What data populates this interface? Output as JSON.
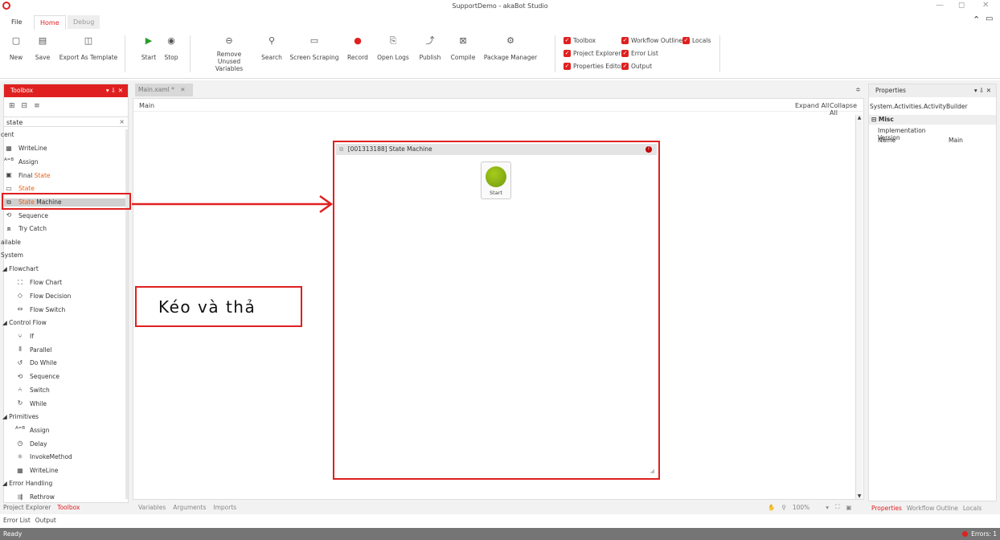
{
  "window": {
    "title": "SupportDemo - akaBot Studio",
    "minimize": "—",
    "restore": "◻",
    "close": "✕"
  },
  "menu": {
    "file": "File",
    "home": "Home",
    "debug": "Debug"
  },
  "ribbon": {
    "buttons": [
      {
        "icon": "▢",
        "label": "New"
      },
      {
        "icon": "▤",
        "label": "Save"
      },
      {
        "icon": "◫",
        "label": "Export As Template"
      },
      {
        "icon": "▶",
        "label": "Start"
      },
      {
        "icon": "◉",
        "label": "Stop"
      },
      {
        "icon": "⊖",
        "label": "Remove Unused Variables"
      },
      {
        "icon": "⚲",
        "label": "Search"
      },
      {
        "icon": "▭",
        "label": "Screen Scraping"
      },
      {
        "icon": "●",
        "label": "Record"
      },
      {
        "icon": "⎘",
        "label": "Open Logs"
      },
      {
        "icon": "⤴",
        "label": "Publish"
      },
      {
        "icon": "⊠",
        "label": "Compile"
      },
      {
        "icon": "⚙",
        "label": "Package Manager"
      }
    ],
    "checks": [
      "Toolbox",
      "Workflow Outline",
      "Locals",
      "Project Explorer",
      "Error List",
      "Properties Editor",
      "Output"
    ]
  },
  "toolbox": {
    "title": "Toolbox",
    "pin": "▾ ⇩ ✕",
    "search_value": "state",
    "search_clear": "×",
    "recent": "cent",
    "recent_items": [
      {
        "icon": "▦",
        "label": "WriteLine"
      },
      {
        "icon": "A=B",
        "label": "Assign"
      },
      {
        "icon": "▣",
        "label_pre": "Final ",
        "label_hl": "State",
        "label_post": ""
      },
      {
        "icon": "▭",
        "label_pre": "",
        "label_hl": "State",
        "label_post": ""
      },
      {
        "icon": "⧉",
        "label_pre": "",
        "label_hl": "State",
        "label_post": " Machine"
      },
      {
        "icon": "⟲",
        "label": "Sequence"
      },
      {
        "icon": "⧈",
        "label": "Try Catch"
      }
    ],
    "available": "ailable",
    "system": "System",
    "groups": [
      {
        "name": "◢ Flowchart",
        "items": [
          {
            "icon": "⛶",
            "label": "Flow Chart"
          },
          {
            "icon": "◇",
            "label": "Flow Decision"
          },
          {
            "icon": "⇔",
            "label": "Flow Switch"
          }
        ]
      },
      {
        "name": "◢ Control Flow",
        "items": [
          {
            "icon": "⑂",
            "label": "If"
          },
          {
            "icon": "⫴",
            "label": "Parallel"
          },
          {
            "icon": "↺",
            "label": "Do While"
          },
          {
            "icon": "⟲",
            "label": "Sequence"
          },
          {
            "icon": "⑃",
            "label": "Switch"
          },
          {
            "icon": "↻",
            "label": "While"
          }
        ]
      },
      {
        "name": "◢ Primitives",
        "items": [
          {
            "icon": "A=B",
            "label": "Assign"
          },
          {
            "icon": "◷",
            "label": "Delay"
          },
          {
            "icon": "⚛",
            "label": "InvokeMethod"
          },
          {
            "icon": "▦",
            "label": "WriteLine"
          }
        ]
      },
      {
        "name": "◢ Error Handling",
        "items": [
          {
            "icon": "⇶",
            "label": "Rethrow"
          }
        ]
      }
    ],
    "bottom_tabs": [
      "Project Explorer",
      "Toolbox"
    ],
    "bottom_tabs2": [
      "Error List",
      "Output"
    ]
  },
  "designer": {
    "tab": "Main.xaml *",
    "tab_close": "✕",
    "breadcrumb": "Main",
    "expand_all": "Expand All",
    "collapse_all": "Collapse All",
    "activity_title": "[001313188] State Machine",
    "start_label": "Start",
    "bottom_tabs": [
      "Variables",
      "Arguments",
      "Imports"
    ],
    "zoom": "100%"
  },
  "annotation": {
    "text": "Kéo và thả"
  },
  "properties": {
    "title": "Properties",
    "pin": "▾ ⇩ ✕",
    "type": "System.Activities.ActivityBuilder",
    "category": "⊟ Misc",
    "rows": [
      {
        "name": "Implementation Version",
        "value": ""
      },
      {
        "name": "Name",
        "value": "Main"
      }
    ],
    "bottom_tabs": [
      "Properties",
      "Workflow Outline",
      "Locals"
    ]
  },
  "status": {
    "left": "Ready",
    "right": "Errors: 1"
  },
  "colors": {
    "accent": "#e02020",
    "highlight": "#e8621a"
  }
}
